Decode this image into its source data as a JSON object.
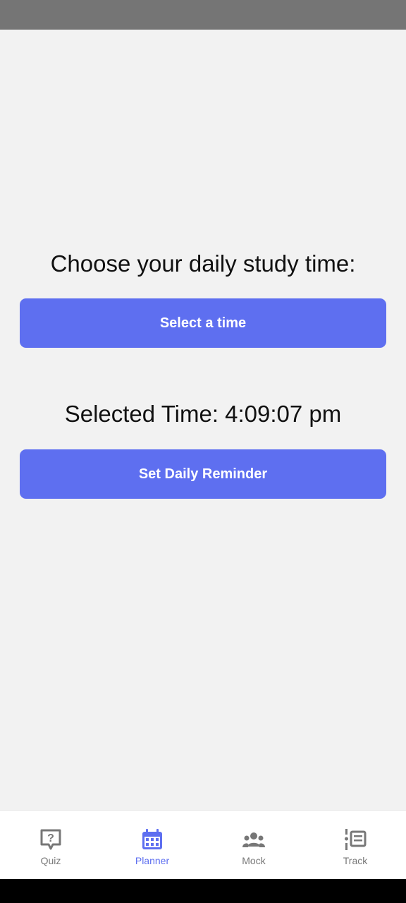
{
  "main": {
    "prompt": "Choose your daily study time:",
    "select_button": "Select a time",
    "selected_time": "Selected Time: 4:09:07 pm",
    "reminder_button": "Set Daily Reminder"
  },
  "nav": {
    "items": [
      {
        "label": "Quiz",
        "icon": "quiz-icon",
        "active": false
      },
      {
        "label": "Planner",
        "icon": "calendar-icon",
        "active": true
      },
      {
        "label": "Mock",
        "icon": "group-icon",
        "active": false
      },
      {
        "label": "Track",
        "icon": "list-icon",
        "active": false
      }
    ]
  },
  "colors": {
    "accent": "#5e6ff0",
    "background": "#f2f2f2",
    "inactive": "#777777"
  }
}
